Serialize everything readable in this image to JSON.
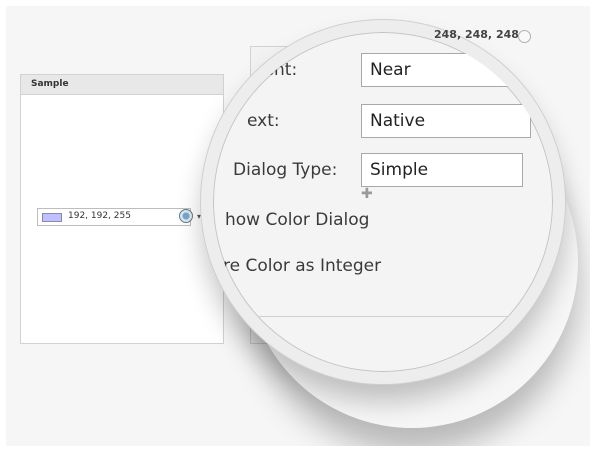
{
  "sample": {
    "header": "Sample",
    "color_text": "192, 192, 255",
    "swatch_color": "#c0c0ff"
  },
  "magnifier": {
    "rgb_readout": "248, 248, 248",
    "rows": [
      {
        "label": "ment:",
        "value": "Near"
      },
      {
        "label": "ext:",
        "value": "Native"
      },
      {
        "label": "Dialog Type:",
        "value": "Simple"
      }
    ],
    "show_dialog_label": "how Color Dialog",
    "integer_label": "re Color as Integer"
  }
}
